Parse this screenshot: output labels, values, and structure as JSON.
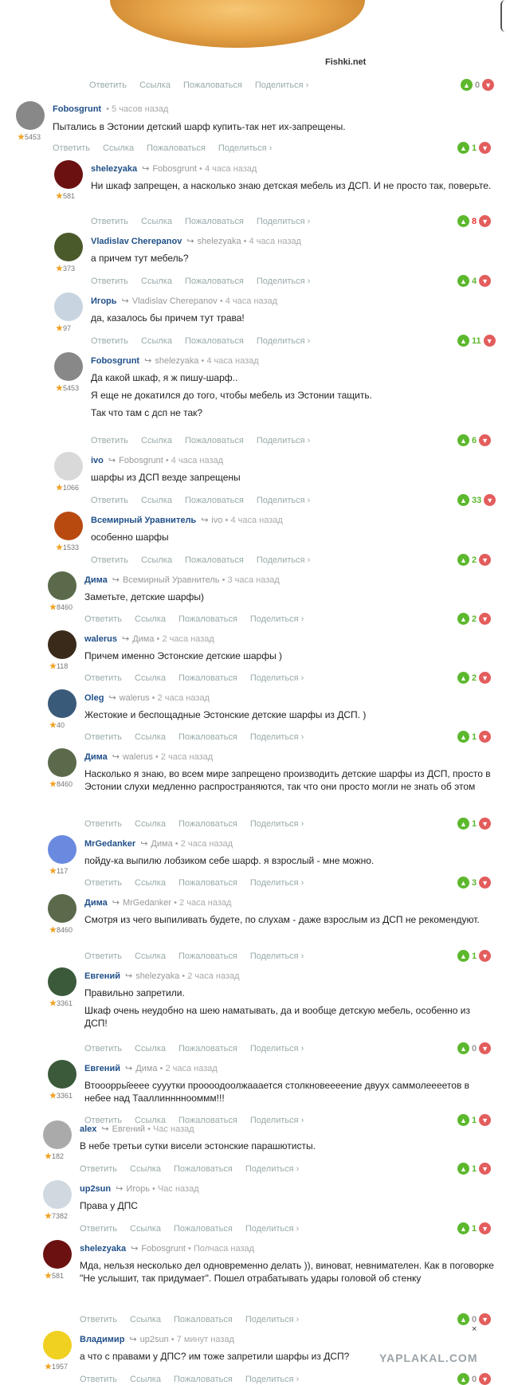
{
  "watermark": "Fishki.net",
  "brand": "YAPLAKAL.COM",
  "action_labels": {
    "reply": "Ответить",
    "link": "Ссылка",
    "report": "Пожаловаться",
    "share": "Поделиться ›"
  },
  "top_votes": {
    "count": "0"
  },
  "comments": [
    {
      "author": "Fobosgrunt",
      "reply_to": "",
      "time": "5 часов назад",
      "rating": "5453",
      "votes": "1",
      "text": [
        "Пытались в Эстонии детский шарф купить-так нет их-запрещены."
      ]
    },
    {
      "author": "shelezyaka",
      "reply_to": "Fobosgrunt",
      "time": "4 часа назад",
      "rating": "581",
      "votes": "8",
      "text": [
        "Ни шкаф запрещен, а насколько знаю детская мебель из ДСП. И не просто так, поверьте."
      ]
    },
    {
      "author": "Vladislav Cherepanov",
      "reply_to": "shelezyaka",
      "time": "4 часа назад",
      "rating": "373",
      "votes": "4",
      "text": [
        "а причем тут мебель?"
      ]
    },
    {
      "author": "Игорь",
      "reply_to": "Vladislav Cherepanov",
      "time": "4 часа назад",
      "rating": "97",
      "votes": "11",
      "text": [
        "да, казалось бы причем тут трава!"
      ]
    },
    {
      "author": "Fobosgrunt",
      "reply_to": "shelezyaka",
      "time": "4 часа назад",
      "rating": "5453",
      "votes": "6",
      "text": [
        "Да какой шкаф, я ж пишу-шарф..",
        "Я еще не докатился до того, чтобы мебель из Эстонии тащить.",
        "Так что там с дсп не так?"
      ]
    },
    {
      "author": "ivo",
      "reply_to": "Fobosgrunt",
      "time": "4 часа назад",
      "rating": "1066",
      "votes": "33",
      "text": [
        "шарфы из ДСП везде запрещены"
      ]
    },
    {
      "author": "Всемирный Уравнитель",
      "reply_to": "ivo",
      "time": "4 часа назад",
      "rating": "1533",
      "votes": "2",
      "text": [
        "особенно шарфы"
      ]
    },
    {
      "author": "Дима",
      "reply_to": "Всемирный Уравнитель",
      "time": "3 часа назад",
      "rating": "8460",
      "votes": "2",
      "text": [
        "Заметьте, детские шарфы)"
      ]
    },
    {
      "author": "walerus",
      "reply_to": "Дима",
      "time": "2 часа назад",
      "rating": "118",
      "votes": "2",
      "text": [
        "Причем именно Эстонские детские шарфы )"
      ]
    },
    {
      "author": "Oleg",
      "reply_to": "walerus",
      "time": "2 часа назад",
      "rating": "40",
      "votes": "1",
      "text": [
        "Жестокие и беспощадные Эстонские детские шарфы из ДСП. )"
      ]
    },
    {
      "author": "Дима",
      "reply_to": "walerus",
      "time": "2 часа назад",
      "rating": "8460",
      "votes": "1",
      "text": [
        "Насколько я знаю, во всем мире запрещено производить детские шарфы из ДСП, просто в Эстонии слухи медленно распространяются, так что они просто могли не знать об этом"
      ]
    },
    {
      "author": "MrGedanker",
      "reply_to": "Дима",
      "time": "2 часа назад",
      "rating": "117",
      "votes": "3",
      "text": [
        "пойду-ка выпилю лобзиком себе шарф. я взрослый - мне можно."
      ]
    },
    {
      "author": "Дима",
      "reply_to": "MrGedanker",
      "time": "2 часа назад",
      "rating": "8460",
      "votes": "1",
      "text": [
        "Смотря из чего выпиливать будете, по слухам - даже взрослым из ДСП не рекомендуют."
      ]
    },
    {
      "author": "Евгений",
      "reply_to": "shelezyaka",
      "time": "2 часа назад",
      "rating": "3361",
      "votes": "0",
      "text": [
        "Правильно запретили.",
        "Шкаф очень неудобно на шею наматывать, да и вообще детскую мебель, особенно из ДСП!"
      ]
    },
    {
      "author": "Евгений",
      "reply_to": "Дима",
      "time": "2 часа назад",
      "rating": "3361",
      "votes": "1",
      "text": [
        "Втооорры̆ееее сууутки проооодоолжааается столкновеееение двуух саммолеееетов в небее над Тааллиннннооммм!!!"
      ]
    },
    {
      "author": "alex",
      "reply_to": "Евгений",
      "time": "Час назад",
      "rating": "182",
      "votes": "1",
      "text": [
        "В небе третьи сутки висели эстонские парашютисты."
      ]
    },
    {
      "author": "up2sun",
      "reply_to": "Игорь",
      "time": "Час назад",
      "rating": "7382",
      "votes": "1",
      "text": [
        "Права у ДПС"
      ]
    },
    {
      "author": "shelezyaka",
      "reply_to": "Fobosgrunt",
      "time": "Полчаса назад",
      "rating": "581",
      "votes": "0",
      "text": [
        "Мда, нельзя несколько дел одновременно делать )), виноват, невнимателен. Как в поговорке \"Не услышит, так придумает\". Пошел отрабатывать удары головой об стенку"
      ]
    },
    {
      "author": "Владимир",
      "reply_to": "up2sun",
      "time": "7 минут назад",
      "rating": "1957",
      "votes": "0",
      "text": [
        "а что с правами у ДПС? им тоже запретили шарфы из ДСП?"
      ]
    }
  ]
}
